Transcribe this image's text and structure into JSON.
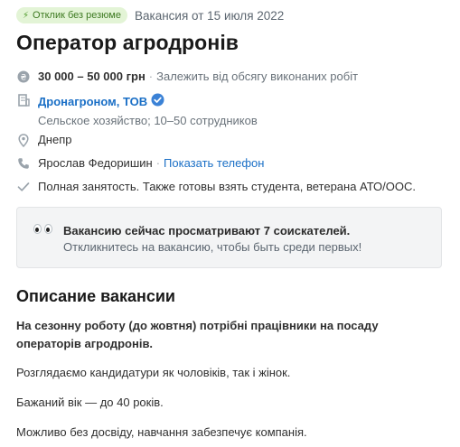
{
  "header": {
    "badge": "Отклик без резюме",
    "posted": "Вакансия от 15 июля 2022",
    "title": "Оператор агродронів"
  },
  "salary": {
    "amount": "30 000 – 50 000 грн",
    "note": "Залежить від обсягу виконаних робіт"
  },
  "company": {
    "name": "Дронагроном, ТОВ",
    "details": "Сельское хозяйство; 10–50 сотрудников"
  },
  "location": {
    "city": "Днепр"
  },
  "contact": {
    "name": "Ярослав Федоришин",
    "show_phone": "Показать телефон"
  },
  "employment": {
    "text": "Полная занятость. Также готовы взять студента, ветерана АТО/ООС."
  },
  "notice": {
    "title": "Вакансию сейчас просматривают 7 соискателей.",
    "subtitle": "Откликнитесь на вакансию, чтобы быть среди первых!"
  },
  "description": {
    "heading": "Описание вакансии",
    "paragraphs": [
      "На сезонну роботу (до жовтня) потрібні працівники на посаду операторів агродронів.",
      "Розглядаємо кандидатури як чоловіків, так і жінок.",
      "Бажаний вік — до 40 років.",
      "Можливо без досвіду, навчання забезпечує компанія."
    ]
  },
  "colors": {
    "link": "#1a6fc6",
    "badge_bg": "#e3f4d6",
    "badge_text": "#3e7a22",
    "verified": "#3b82d6"
  },
  "icons": [
    "bolt-icon",
    "hryvnia-icon",
    "building-icon",
    "verified-icon",
    "location-pin-icon",
    "phone-icon",
    "checkmark-icon",
    "eyes-icon"
  ]
}
